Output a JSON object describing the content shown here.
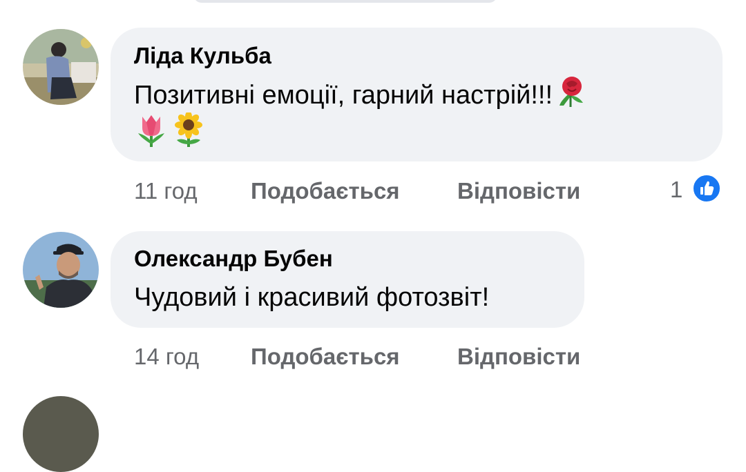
{
  "comments": [
    {
      "author": "Ліда Кульба",
      "text_line1": "Позитивні  емоції, гарний  настрій!!!",
      "emoji_line1": [
        "rose-emoji"
      ],
      "emoji_line2": [
        "tulip-emoji",
        "sunflower-emoji"
      ],
      "time": "11 год",
      "like_label": "Подобається",
      "reply_label": "Відповісти",
      "reaction_count": "1",
      "reaction_icon": "thumbs-up-icon"
    },
    {
      "author": "Олександр Бубен",
      "text_line1": "Чудовий і красивий фотозвіт!",
      "time": "14 год",
      "like_label": "Подобається",
      "reply_label": "Відповісти"
    }
  ],
  "colors": {
    "bubble": "#f0f2f5",
    "meta": "#65676b",
    "like_blue": "#1877f2"
  }
}
